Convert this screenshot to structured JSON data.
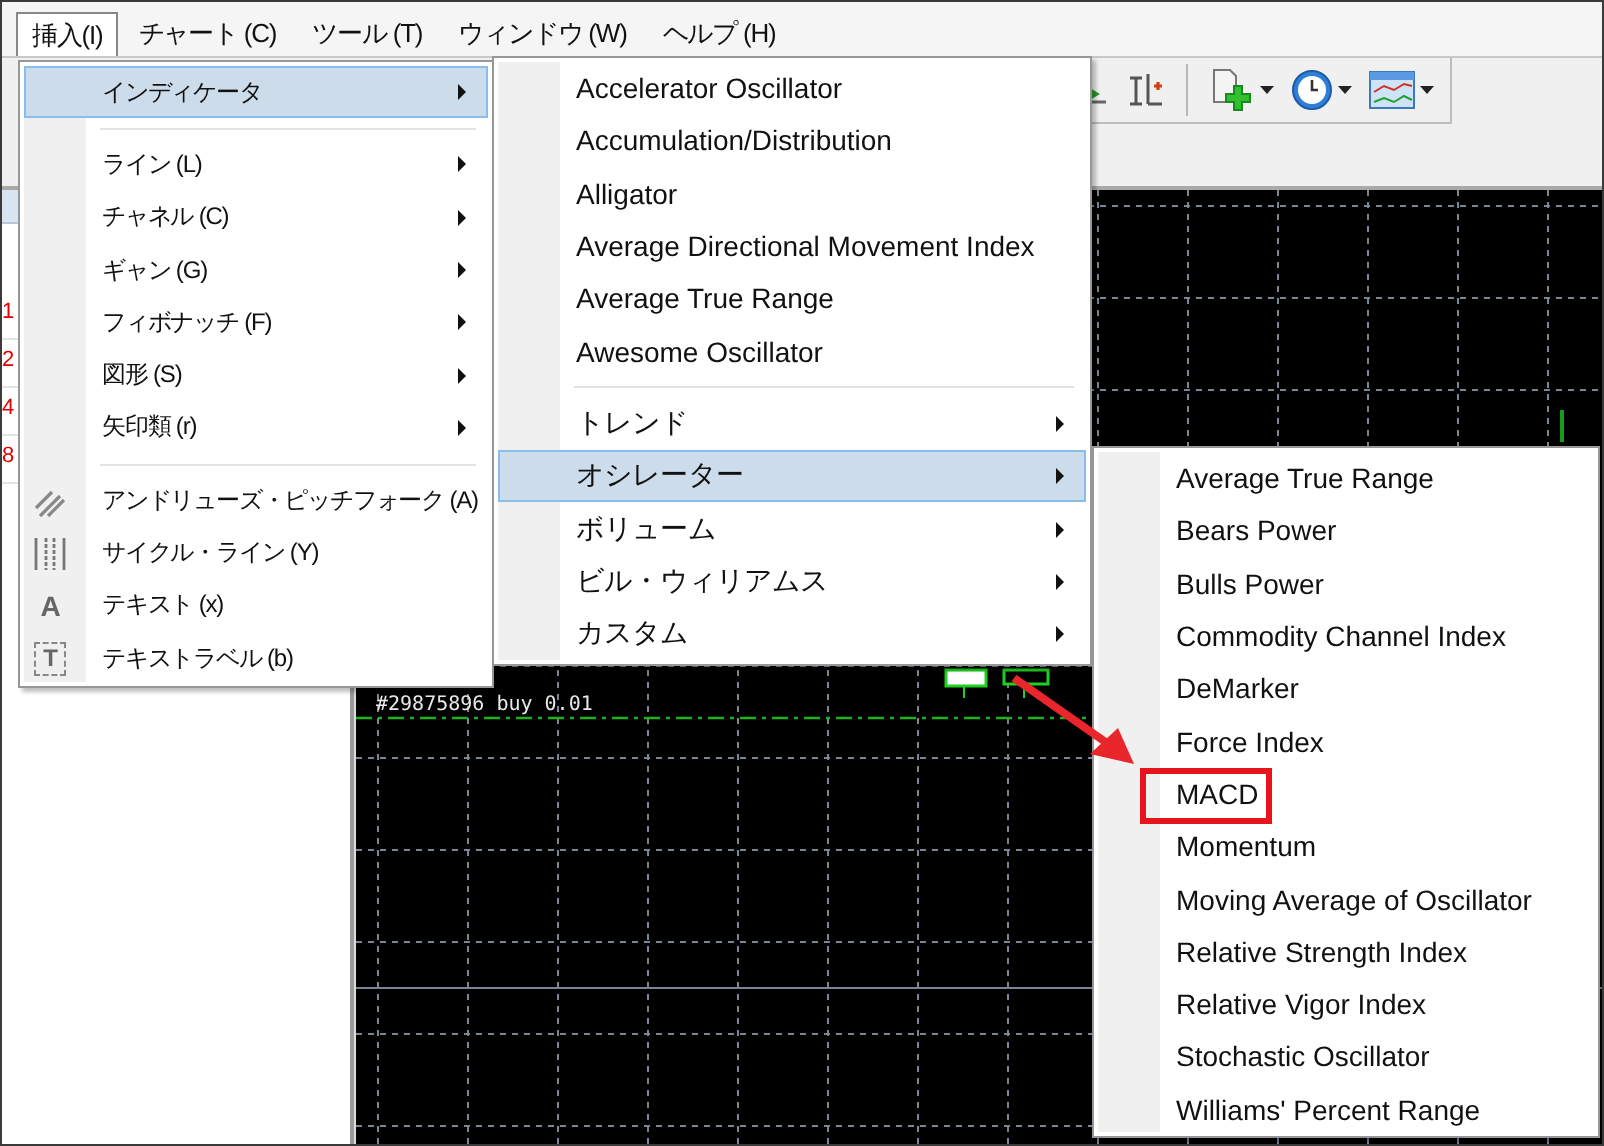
{
  "menubar": [
    {
      "label": "挿入(I)",
      "selected": true
    },
    {
      "label": "チャート (C)",
      "selected": false
    },
    {
      "label": "ツール (T)",
      "selected": false
    },
    {
      "label": "ウィンドウ (W)",
      "selected": false
    },
    {
      "label": "ヘルプ (H)",
      "selected": false
    }
  ],
  "left_panel": {
    "labels": [
      "1",
      "2",
      "4",
      "8"
    ]
  },
  "chart": {
    "trade_label": "#29875896 buy 0.01"
  },
  "menus": [
    {
      "items": [
        {
          "kind": "item",
          "label": "インディケータ",
          "submenu": true,
          "selected": true,
          "callout": false
        },
        {
          "kind": "separator"
        },
        {
          "kind": "item",
          "label": "ライン (L)",
          "submenu": true,
          "selected": false,
          "callout": false
        },
        {
          "kind": "item",
          "label": "チャネル (C)",
          "submenu": true,
          "selected": false,
          "callout": false
        },
        {
          "kind": "item",
          "label": "ギャン (G)",
          "submenu": true,
          "selected": false,
          "callout": false
        },
        {
          "kind": "item",
          "label": "フィボナッチ (F)",
          "submenu": true,
          "selected": false,
          "callout": false
        },
        {
          "kind": "item",
          "label": "図形 (S)",
          "submenu": true,
          "selected": false,
          "callout": false
        },
        {
          "kind": "item",
          "label": "矢印類 (r)",
          "submenu": true,
          "selected": false,
          "callout": false
        },
        {
          "kind": "separator"
        },
        {
          "kind": "pitchfork",
          "label": "アンドリューズ・ピッチフォーク (A)",
          "submenu": false,
          "selected": false,
          "callout": false
        },
        {
          "kind": "cycle",
          "label": "サイクル・ライン (Y)",
          "submenu": false,
          "selected": false,
          "callout": false
        },
        {
          "kind": "text",
          "label": "テキスト (x)",
          "submenu": false,
          "selected": false,
          "callout": false,
          "icon_text": "A"
        },
        {
          "kind": "label",
          "label": "テキストラベル (b)",
          "submenu": false,
          "selected": false,
          "callout": false,
          "icon_text": "T"
        }
      ]
    },
    {
      "items": [
        {
          "kind": "item",
          "label": "Accelerator Oscillator",
          "submenu": false,
          "selected": false,
          "callout": false
        },
        {
          "kind": "item",
          "label": "Accumulation/Distribution",
          "submenu": false,
          "selected": false,
          "callout": false
        },
        {
          "kind": "item",
          "label": "Alligator",
          "submenu": false,
          "selected": false,
          "callout": false
        },
        {
          "kind": "item",
          "label": "Average Directional Movement Index",
          "submenu": false,
          "selected": false,
          "callout": false
        },
        {
          "kind": "item",
          "label": "Average True Range",
          "submenu": false,
          "selected": false,
          "callout": false
        },
        {
          "kind": "item",
          "label": "Awesome Oscillator",
          "submenu": false,
          "selected": false,
          "callout": false
        },
        {
          "kind": "separator"
        },
        {
          "kind": "item",
          "label": "トレンド",
          "submenu": true,
          "selected": false,
          "callout": false
        },
        {
          "kind": "item",
          "label": "オシレーター",
          "submenu": true,
          "selected": true,
          "callout": false
        },
        {
          "kind": "item",
          "label": "ボリューム",
          "submenu": true,
          "selected": false,
          "callout": false
        },
        {
          "kind": "item",
          "label": "ビル・ウィリアムス",
          "submenu": true,
          "selected": false,
          "callout": false
        },
        {
          "kind": "item",
          "label": "カスタム",
          "submenu": true,
          "selected": false,
          "callout": false
        }
      ]
    },
    {
      "items": [
        {
          "kind": "item",
          "label": "Average True Range",
          "submenu": false,
          "selected": false,
          "callout": false
        },
        {
          "kind": "item",
          "label": "Bears Power",
          "submenu": false,
          "selected": false,
          "callout": false
        },
        {
          "kind": "item",
          "label": "Bulls Power",
          "submenu": false,
          "selected": false,
          "callout": false
        },
        {
          "kind": "item",
          "label": "Commodity Channel Index",
          "submenu": false,
          "selected": false,
          "callout": false
        },
        {
          "kind": "item",
          "label": "DeMarker",
          "submenu": false,
          "selected": false,
          "callout": false
        },
        {
          "kind": "item",
          "label": "Force Index",
          "submenu": false,
          "selected": false,
          "callout": false
        },
        {
          "kind": "item",
          "label": "MACD",
          "submenu": false,
          "selected": false,
          "callout": true
        },
        {
          "kind": "item",
          "label": "Momentum",
          "submenu": false,
          "selected": false,
          "callout": false
        },
        {
          "kind": "item",
          "label": "Moving Average of Oscillator",
          "submenu": false,
          "selected": false,
          "callout": false
        },
        {
          "kind": "item",
          "label": "Relative Strength Index",
          "submenu": false,
          "selected": false,
          "callout": false
        },
        {
          "kind": "item",
          "label": "Relative Vigor Index",
          "submenu": false,
          "selected": false,
          "callout": false
        },
        {
          "kind": "item",
          "label": "Stochastic Oscillator",
          "submenu": false,
          "selected": false,
          "callout": false
        },
        {
          "kind": "item",
          "label": "Williams' Percent Range",
          "submenu": false,
          "selected": false,
          "callout": false
        }
      ]
    }
  ]
}
